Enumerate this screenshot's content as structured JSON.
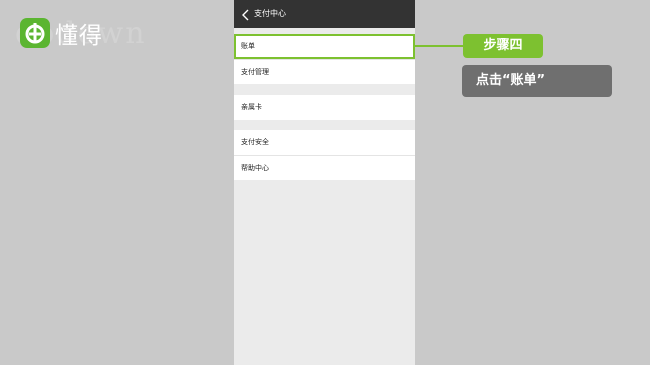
{
  "brand": {
    "logo_text": "懂得",
    "watermark_text": "dodown"
  },
  "phone": {
    "title": "支付中心",
    "groups": [
      {
        "items": [
          {
            "label": "账单",
            "highlighted": true
          },
          {
            "label": "支付管理"
          }
        ]
      },
      {
        "items": [
          {
            "label": "亲属卡"
          }
        ]
      },
      {
        "items": [
          {
            "label": "支付安全"
          },
          {
            "label": "帮助中心"
          }
        ]
      }
    ]
  },
  "callout": {
    "step": "步骤四",
    "description": "点击“账单”"
  },
  "colors": {
    "accent": "#7dc130",
    "titlebar": "#333333",
    "background": "#c9c9c9"
  }
}
